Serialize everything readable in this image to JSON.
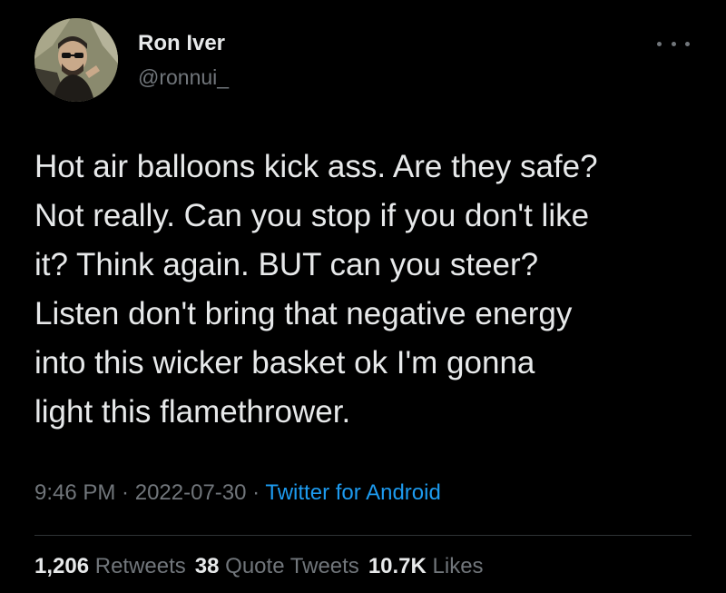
{
  "author": {
    "name": "Ron Iver",
    "handle": "@ronnui_"
  },
  "more_icon": "ellipsis-icon",
  "tweet_lines": [
    "Hot air balloons kick ass. Are they safe?",
    "Not really. Can you stop if you don't like",
    "it? Think again. BUT can you steer?",
    "Listen don't bring that negative energy",
    "into this wicker basket ok I'm gonna",
    "light this flamethrower."
  ],
  "meta": {
    "time": "9:46 PM",
    "separator": " · ",
    "date": "2022-07-30",
    "source": "Twitter for Android"
  },
  "stats": {
    "retweets_count": "1,206",
    "retweets_label": "Retweets",
    "quotes_count": "38",
    "quotes_label": "Quote Tweets",
    "likes_count": "10.7K",
    "likes_label": "Likes"
  },
  "colors": {
    "background": "#000000",
    "text_primary": "#e7e9ea",
    "text_secondary": "#71767b",
    "link": "#1d9bf0",
    "divider": "#2f3336"
  }
}
